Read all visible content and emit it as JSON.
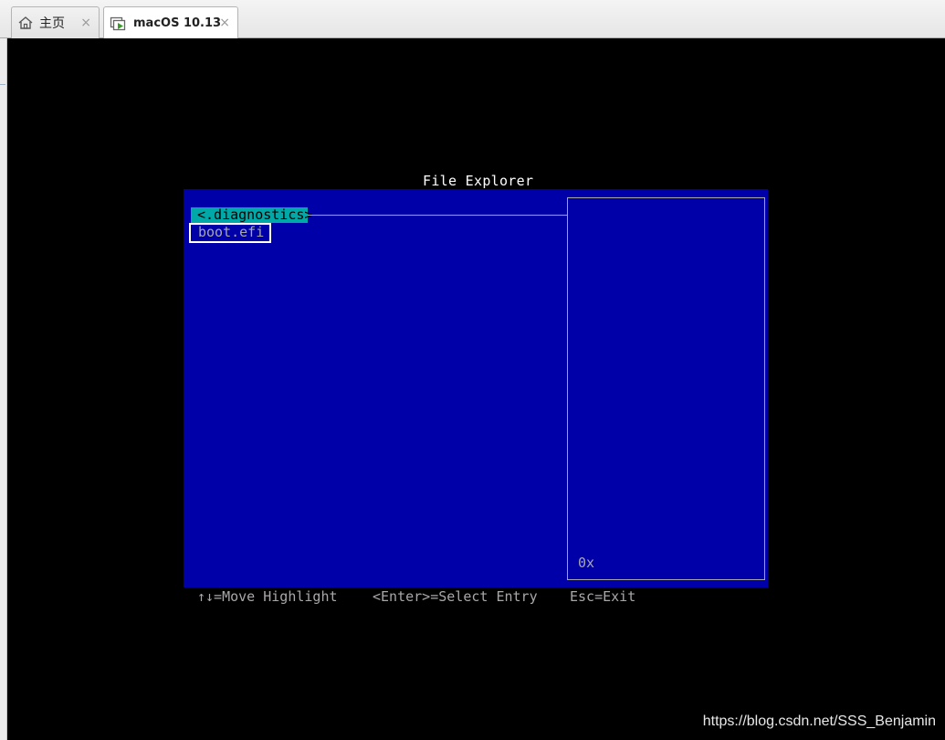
{
  "tabs": [
    {
      "label": "主页",
      "icon": "home-icon",
      "close": "×"
    },
    {
      "label": "macOS 10.13",
      "icon": "vm-icon",
      "close": "×",
      "active": true
    }
  ],
  "explorer": {
    "title": "File Explorer",
    "entries": [
      "<.diagnostics>",
      "boot.efi"
    ],
    "info_value": "0x"
  },
  "hints": {
    "move": "↑↓=Move Highlight",
    "select": "<Enter>=Select Entry",
    "exit": "Esc=Exit"
  },
  "watermark": "https://blog.csdn.net/SSS_Benjamin",
  "colors": {
    "panel_bg": "#0000a8",
    "highlight_bg": "#00a8a8",
    "text_grey": "#a8a8a8",
    "screen_bg": "#000000"
  }
}
